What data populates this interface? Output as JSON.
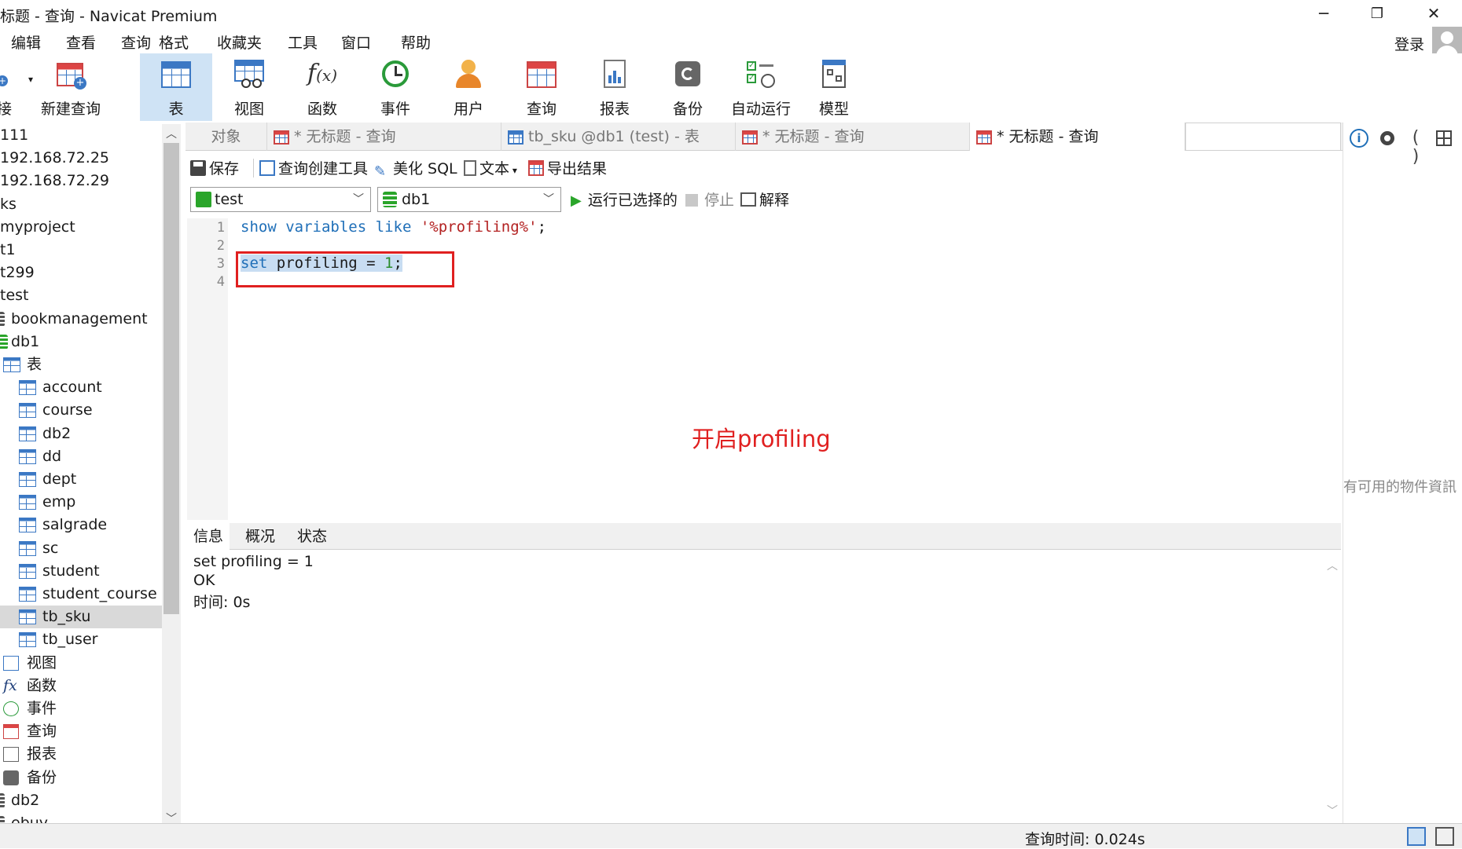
{
  "window": {
    "title": "标题 - 查询 - Navicat Premium",
    "minimize": "─",
    "restore": "❐",
    "close": "✕"
  },
  "menu": {
    "items": [
      "编辑",
      "查看",
      "查询",
      "格式",
      "收藏夹",
      "工具",
      "窗口",
      "帮助"
    ],
    "login": "登录"
  },
  "toolbar": {
    "items": [
      {
        "label": "接",
        "icon": "connection-icon"
      },
      {
        "label": "新建查询",
        "icon": "new-query-icon"
      },
      {
        "label": "表",
        "icon": "table-icon"
      },
      {
        "label": "视图",
        "icon": "view-icon"
      },
      {
        "label": "函数",
        "icon": "function-icon"
      },
      {
        "label": "事件",
        "icon": "event-icon"
      },
      {
        "label": "用户",
        "icon": "user-icon"
      },
      {
        "label": "查询",
        "icon": "query-icon"
      },
      {
        "label": "报表",
        "icon": "report-icon"
      },
      {
        "label": "备份",
        "icon": "backup-icon"
      },
      {
        "label": "自动运行",
        "icon": "automation-icon"
      },
      {
        "label": "模型",
        "icon": "model-icon"
      }
    ],
    "active": "表"
  },
  "sidebar": {
    "items": [
      {
        "label": "111",
        "type": "text"
      },
      {
        "label": "192.168.72.25",
        "type": "text"
      },
      {
        "label": "192.168.72.29",
        "type": "text"
      },
      {
        "label": "ks",
        "type": "text"
      },
      {
        "label": "myproject",
        "type": "text"
      },
      {
        "label": "t1",
        "type": "text"
      },
      {
        "label": "t299",
        "type": "text"
      },
      {
        "label": "test",
        "type": "text"
      },
      {
        "label": "bookmanagement",
        "type": "db"
      },
      {
        "label": "db1",
        "type": "db-open"
      },
      {
        "label": "表",
        "type": "folder-table"
      },
      {
        "label": "account",
        "type": "table"
      },
      {
        "label": "course",
        "type": "table"
      },
      {
        "label": "db2",
        "type": "table"
      },
      {
        "label": "dd",
        "type": "table"
      },
      {
        "label": "dept",
        "type": "table"
      },
      {
        "label": "emp",
        "type": "table"
      },
      {
        "label": "salgrade",
        "type": "table"
      },
      {
        "label": "sc",
        "type": "table"
      },
      {
        "label": "student",
        "type": "table"
      },
      {
        "label": "student_course",
        "type": "table"
      },
      {
        "label": "tb_sku",
        "type": "table",
        "selected": true
      },
      {
        "label": "tb_user",
        "type": "table"
      },
      {
        "label": "视图",
        "type": "folder-view"
      },
      {
        "label": "函数",
        "type": "folder-function"
      },
      {
        "label": "事件",
        "type": "folder-event"
      },
      {
        "label": "查询",
        "type": "folder-query"
      },
      {
        "label": "报表",
        "type": "folder-report"
      },
      {
        "label": "备份",
        "type": "folder-backup"
      },
      {
        "label": "db2",
        "type": "db"
      },
      {
        "label": "ebuy",
        "type": "db"
      }
    ]
  },
  "tabs": {
    "items": [
      {
        "label": "对象",
        "active": false
      },
      {
        "label": "* 无标题 - 查询",
        "active": false
      },
      {
        "label": "tb_sku @db1 (test) - 表",
        "active": false
      },
      {
        "label": "* 无标题 - 查询",
        "active": false
      },
      {
        "label": "* 无标题 - 查询",
        "active": true
      }
    ]
  },
  "query_toolbar": {
    "save": "保存",
    "builder": "查询创建工具",
    "beautify": "美化 SQL",
    "text": "文本",
    "export": "导出结果",
    "connection": "test",
    "database": "db1",
    "run_selected": "运行已选择的",
    "stop": "停止",
    "explain": "解释"
  },
  "editor": {
    "line_numbers": [
      "1",
      "2",
      "3",
      "4"
    ],
    "line1": {
      "kw1": "show",
      "kw2": "variables",
      "kw3": "like",
      "str": "'%profiling%'",
      "end": ";"
    },
    "line3": {
      "kw": "set",
      "rest": " profiling = ",
      "num": "1",
      "end": ";"
    },
    "annotation": "开启profiling"
  },
  "result_tabs": [
    "信息",
    "概况",
    "状态"
  ],
  "output": {
    "lines": [
      "set profiling = 1",
      "OK",
      "时间: 0s"
    ]
  },
  "right_panel": {
    "message": "有可用的物件資訊"
  },
  "status": {
    "query_time": "查询时间: 0.024s"
  },
  "colors": {
    "accent": "#3b78c4",
    "annotation": "#e02020",
    "active_toolbar": "#cfe3f5"
  }
}
